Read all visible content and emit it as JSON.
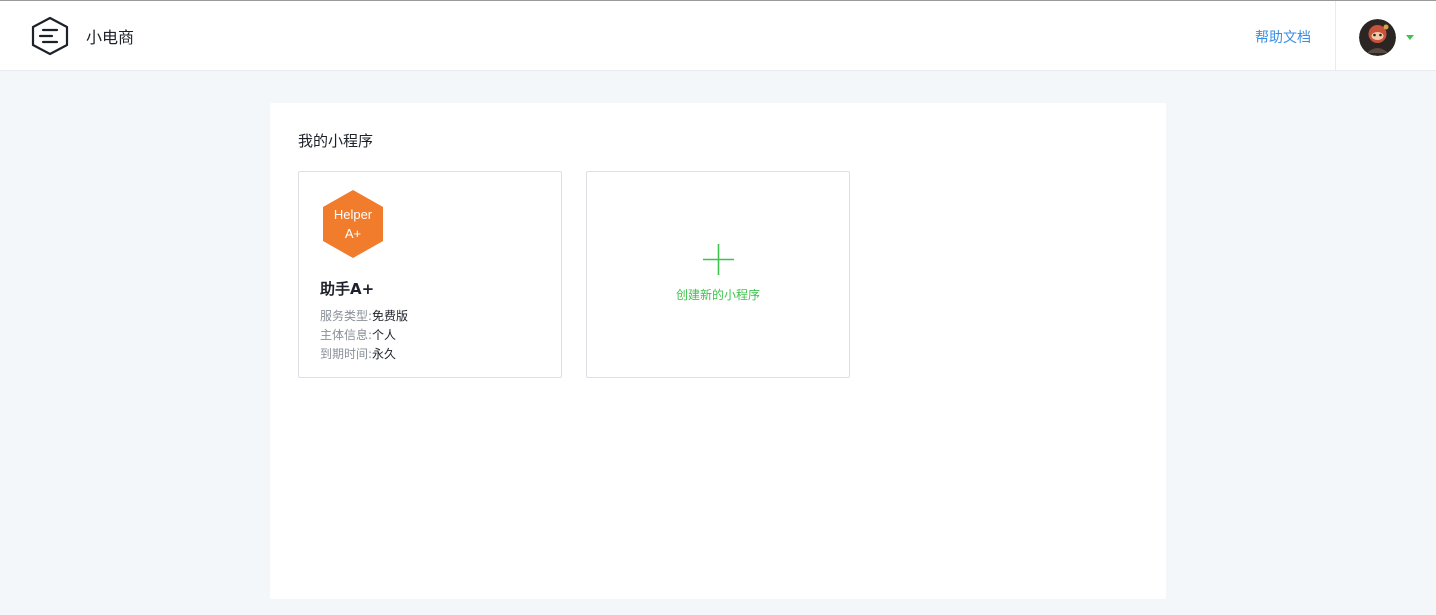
{
  "header": {
    "brand_name": "小电商",
    "logo_icon": "hexagon-logo-icon",
    "help_link": "帮助文档",
    "avatar_icon": "user-avatar",
    "caret_icon": "chevron-down-icon",
    "accent_color": "#3ec34c",
    "link_color": "#3a8ee6"
  },
  "main": {
    "section_title": "我的小程序",
    "apps": [
      {
        "icon_text_line1": "Helper",
        "icon_text_line2": "A+",
        "icon_color": "#f07c2c",
        "name": "助手A+",
        "service_type_label": "服务类型:",
        "service_type": "免费版",
        "subject_label": "主体信息:",
        "subject": "个人",
        "expire_label": "到期时间:",
        "expire": "永久"
      }
    ],
    "create_label": "创建新的小程序",
    "create_icon": "plus-icon"
  }
}
